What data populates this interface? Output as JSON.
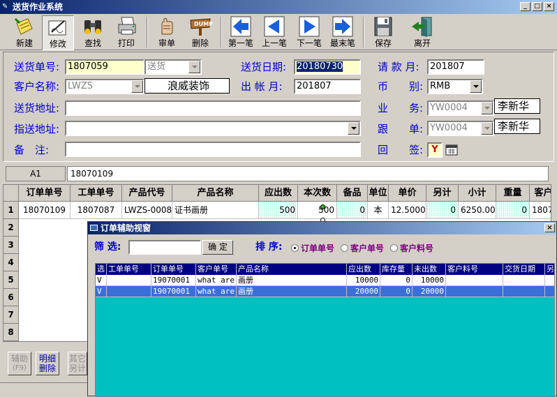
{
  "window": {
    "title": "送货作业系统",
    "min": "_",
    "max": "□",
    "close": "×"
  },
  "toolbar": [
    {
      "label": "新建",
      "icon": "new-doc-icon"
    },
    {
      "label": "修改",
      "icon": "edit-pen-icon"
    },
    {
      "label": "查找",
      "icon": "binoculars-icon"
    },
    {
      "label": "打印",
      "icon": "printer-icon"
    },
    {
      "label": "审单",
      "icon": "approve-hand-icon"
    },
    {
      "label": "删除",
      "icon": "dump-sign-icon"
    },
    {
      "label": "第一笔",
      "icon": "arrow-left-icon"
    },
    {
      "label": "上一笔",
      "icon": "triangle-left-icon"
    },
    {
      "label": "下一笔",
      "icon": "triangle-right-icon"
    },
    {
      "label": "最末笔",
      "icon": "arrow-right-icon"
    },
    {
      "label": "保存",
      "icon": "floppy-icon"
    },
    {
      "label": "离开",
      "icon": "exit-door-icon"
    }
  ],
  "dump_text": "DUMP",
  "form": {
    "delivery_no_label": "送货单号:",
    "delivery_no": "1807059",
    "delivery_type": "送货",
    "delivery_date_label": "送货日期:",
    "delivery_date": "20180730",
    "billing_month_label": "请 款 月:",
    "billing_month": "201807",
    "customer_label": "客户名称:",
    "customer_code": "LWZS",
    "customer_name": "浪威装饰",
    "ledger_month_label": "出 帐 月:",
    "ledger_month": "201807",
    "currency_label": "币　　别:",
    "currency": "RMB",
    "address_label": "送货地址:",
    "address": "",
    "sales_label": "业　　务:",
    "sales_code": "YW0004",
    "sales_name": "李新华",
    "ship_to_label": "指送地址:",
    "ship_to": "",
    "follow_label": "跟　　单:",
    "follow_code": "YW0004",
    "follow_name": "李新华",
    "remark_label": "备　注:",
    "remark": "",
    "return_label": "回　　签:",
    "return_value": "Y"
  },
  "cellbar": {
    "ref": "A1",
    "value": "18070109"
  },
  "grid": {
    "headers": [
      "订单单号",
      "工单单号",
      "产品代号",
      "产品名称",
      "应出数",
      "本次数",
      "备品",
      "单位",
      "单价",
      "另计",
      "小计",
      "重量",
      "客户"
    ],
    "row_numbers": [
      "1",
      "2",
      "3",
      "4",
      "5",
      "6",
      "7",
      "8"
    ],
    "rows": [
      [
        "18070109",
        "1807087",
        "LWZS-0008",
        "证书画册",
        "500",
        "500",
        "0",
        "本",
        "12.5000",
        "0",
        "6250.00",
        "0",
        "1807"
      ]
    ]
  },
  "bottom_buttons": [
    {
      "label": "辅助",
      "sub": "(F9)"
    },
    {
      "label": "明细",
      "sub": "删除"
    },
    {
      "label": "其它",
      "sub": "另计"
    }
  ],
  "popup": {
    "title": "订单辅助视窗",
    "close": "×",
    "filter_label": "筛 选:",
    "filter_value": "",
    "ok_button": "确 定",
    "sort_label": "排 序:",
    "sort_options": [
      "订单单号",
      "客户单号",
      "客户料号"
    ],
    "sort_selected": 0,
    "columns": [
      "选",
      "工单单号",
      "订单单号",
      "客户单号",
      "产品名称",
      "应出数",
      "库存量",
      "未出数",
      "客户料号",
      "交货日期",
      "另"
    ],
    "rows": [
      [
        "V",
        "",
        "19070001",
        "what are",
        "画册",
        "10000",
        "0",
        "10000",
        "",
        "",
        ""
      ],
      [
        "V",
        "",
        "19070001",
        "what are",
        "画册",
        "20000",
        "0",
        "20000",
        "",
        "",
        ""
      ]
    ]
  }
}
